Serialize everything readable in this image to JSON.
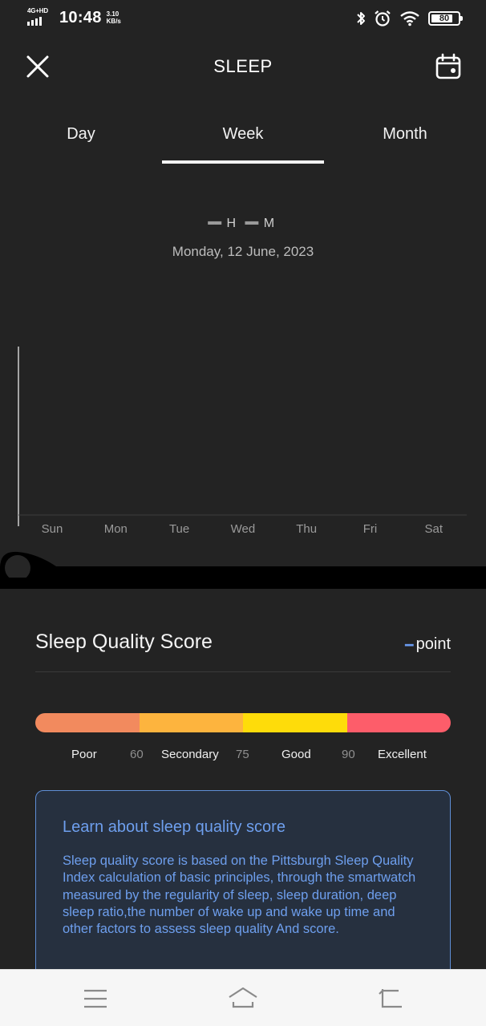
{
  "status_bar": {
    "network": "4G+HD",
    "time": "10:48",
    "speed_value": "3.10",
    "speed_unit": "KB/s",
    "battery": "80",
    "battery_level": 0.8,
    "icons": [
      "bluetooth-icon",
      "alarm-icon",
      "wifi-icon",
      "battery-icon"
    ]
  },
  "header": {
    "title": "SLEEP",
    "close_icon": "close-icon",
    "calendar_icon": "calendar-icon"
  },
  "tabs": [
    {
      "label": "Day",
      "active": false
    },
    {
      "label": "Week",
      "active": true
    },
    {
      "label": "Month",
      "active": false
    }
  ],
  "summary": {
    "hours": "--",
    "hours_unit": "H",
    "minutes": "--",
    "minutes_unit": "M",
    "date": "Monday, 12 June, 2023"
  },
  "chart_data": {
    "type": "bar",
    "categories": [
      "Sun",
      "Mon",
      "Tue",
      "Wed",
      "Thu",
      "Fri",
      "Sat"
    ],
    "values": [
      null,
      null,
      null,
      null,
      null,
      null,
      null
    ]
  },
  "score": {
    "title": "Sleep Quality Score",
    "value": "--",
    "unit": "point",
    "segments": [
      {
        "color": "#f28a5e"
      },
      {
        "color": "#fdb43e"
      },
      {
        "color": "#fedc0a"
      },
      {
        "color": "#fd5d6a"
      }
    ],
    "scale": {
      "poor": "Poor",
      "t1": "60",
      "secondary": "Secondary",
      "t2": "75",
      "good": "Good",
      "t3": "90",
      "excellent": "Excellent"
    }
  },
  "info": {
    "title": "Learn about sleep quality score",
    "body": "Sleep quality score is based on the Pittsburgh Sleep Quality Index calculation of basic principles, through the smartwatch measured by the regularity of sleep, sleep duration, deep sleep ratio,the number of wake up and wake up time and other factors to assess sleep quality And score."
  },
  "nav": [
    "menu-icon",
    "home-icon",
    "back-icon"
  ],
  "colors": {
    "background": "#232323",
    "accent_blue": "#6e9fee",
    "card_bg": "#26303f"
  }
}
